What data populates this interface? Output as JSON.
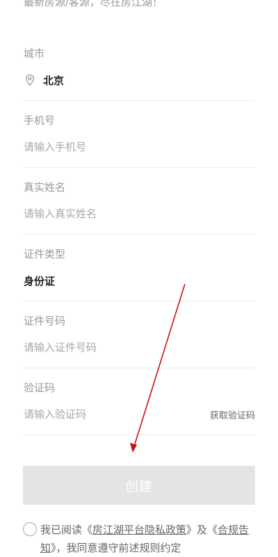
{
  "intro_text": "最新房源/客源，尽在房江湖！",
  "fields": {
    "city": {
      "label": "城市",
      "value": "北京"
    },
    "phone": {
      "label": "手机号",
      "placeholder": "请输入手机号"
    },
    "name": {
      "label": "真实姓名",
      "placeholder": "请输入真实姓名"
    },
    "id_type": {
      "label": "证件类型",
      "value": "身份证"
    },
    "id_number": {
      "label": "证件号码",
      "placeholder": "请输入证件号码"
    },
    "verify_code": {
      "label": "验证码",
      "placeholder": "请输入验证码",
      "get_code": "获取验证码"
    }
  },
  "create_button": "创建",
  "agreement": {
    "prefix": "我已阅读《",
    "privacy_link": "房江湖平台隐私政策",
    "middle": "》及《",
    "compliance_link": "合规告知",
    "suffix": "》，我同意遵守前述规则约定"
  },
  "colors": {
    "annotation_arrow": "#cc1111",
    "button_disabled": "#e4e4e4"
  }
}
